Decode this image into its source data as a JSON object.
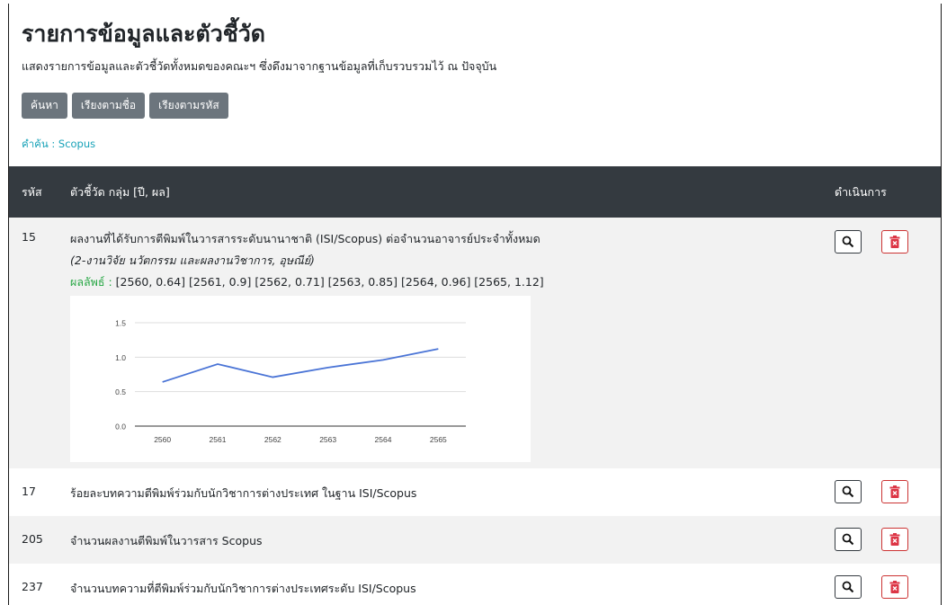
{
  "header": {
    "title": "รายการข้อมูลและตัวชี้วัด",
    "subtitle": "แสดงรายการข้อมูลและตัวชี้วัดทั้งหมดของคณะฯ ซึ่งดึงมาจากฐานข้อมูลที่เก็บรวบรวมไว้ ณ ปัจจุบัน"
  },
  "toolbar": {
    "search_label": "ค้นหา",
    "sort_name_label": "เรียงตามชื่อ",
    "sort_code_label": "เรียงตามรหัส"
  },
  "query": {
    "text": "คำค้น : Scopus"
  },
  "table": {
    "headers": {
      "code": "รหัส",
      "indicator": "ตัวชี้วัด กลุ่ม [ปี, ผล]",
      "actions": "ดำเนินการ"
    },
    "rows": [
      {
        "code": "15",
        "name": "ผลงานที่ได้รับการตีพิมพ์ในวารสารระดับนานาชาติ (ISI/Scopus) ต่อจำนวนอาจารย์ประจำทั้งหมด",
        "group": "(2-งานวิจัย นวัตกรรม และผลงานวิชาการ, อุษณีย์)",
        "result_label": "ผลลัพธ์ :",
        "result_values": " [2560, 0.64] [2561, 0.9] [2562, 0.71] [2563, 0.85] [2564, 0.96] [2565, 1.12]"
      },
      {
        "code": "17",
        "name": "ร้อยละบทความตีพิมพ์ร่วมกับนักวิชาการต่างประเทศ ในฐาน ISI/Scopus"
      },
      {
        "code": "205",
        "name": "จำนวนผลงานตีพิมพ์ในวารสาร Scopus"
      },
      {
        "code": "237",
        "name": "จำนวนบทความที่ตีพิมพ์ร่วมกับนักวิชาการต่างประเทศระดับ ISI/Scopus"
      }
    ]
  },
  "icons": {
    "view": "search-icon",
    "delete": "trash-icon"
  },
  "colors": {
    "header_bg": "#343a40",
    "button_bg": "#6c757d",
    "query_text": "#17a2b8",
    "result_label": "#28a745",
    "delete_icon": "#dc3545",
    "line": "#4a74d6"
  },
  "chart_data": {
    "type": "line",
    "x": [
      "2560",
      "2561",
      "2562",
      "2563",
      "2564",
      "2565"
    ],
    "values": [
      0.64,
      0.9,
      0.71,
      0.85,
      0.96,
      1.12
    ],
    "ylim": [
      0,
      1.5
    ],
    "yticks": [
      "0.0",
      "0.5",
      "1.0",
      "1.5"
    ],
    "grid": true,
    "legend": "none"
  }
}
